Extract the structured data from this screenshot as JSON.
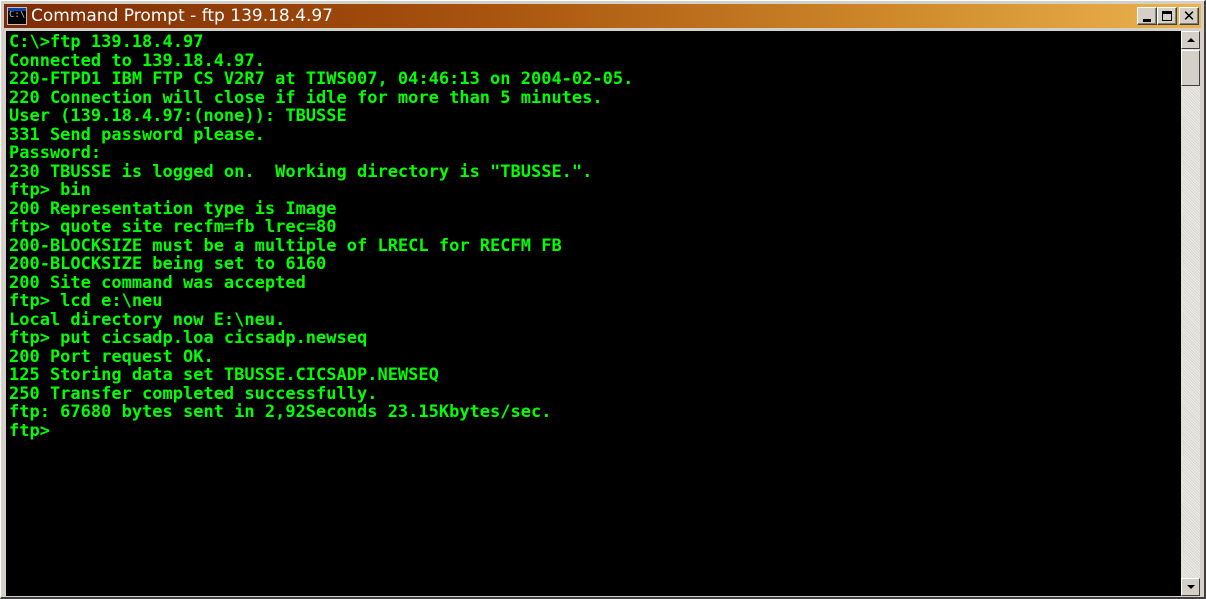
{
  "window": {
    "title": "Command Prompt - ftp 139.18.4.97",
    "icon": "cmd-icon",
    "icon_text": "C:\\",
    "title_gradient": [
      "#7d2b06",
      "#ebb44e"
    ]
  },
  "console": {
    "text_color": "#00ff00",
    "background": "#000000",
    "lines": [
      "C:\\>ftp 139.18.4.97",
      "Connected to 139.18.4.97.",
      "220-FTPD1 IBM FTP CS V2R7 at TIWS007, 04:46:13 on 2004-02-05.",
      "220 Connection will close if idle for more than 5 minutes.",
      "User (139.18.4.97:(none)): TBUSSE",
      "331 Send password please.",
      "Password:",
      "230 TBUSSE is logged on.  Working directory is \"TBUSSE.\".",
      "ftp> bin",
      "200 Representation type is Image",
      "ftp> quote site recfm=fb lrec=80",
      "200-BLOCKSIZE must be a multiple of LRECL for RECFM FB",
      "200-BLOCKSIZE being set to 6160",
      "200 Site command was accepted",
      "ftp> lcd e:\\neu",
      "Local directory now E:\\neu.",
      "ftp> put cicsadp.loa cicsadp.newseq",
      "200 Port request OK.",
      "125 Storing data set TBUSSE.CICSADP.NEWSEQ",
      "250 Transfer completed successfully.",
      "ftp: 67680 bytes sent in 2,92Seconds 23.15Kbytes/sec.",
      "ftp>"
    ]
  },
  "controls": {
    "minimize_icon": "minimize-icon",
    "maximize_icon": "maximize-icon",
    "close_icon": "close-icon"
  },
  "scrollbar": {
    "up_icon": "arrow-up-icon",
    "down_icon": "arrow-down-icon",
    "position": 0
  }
}
